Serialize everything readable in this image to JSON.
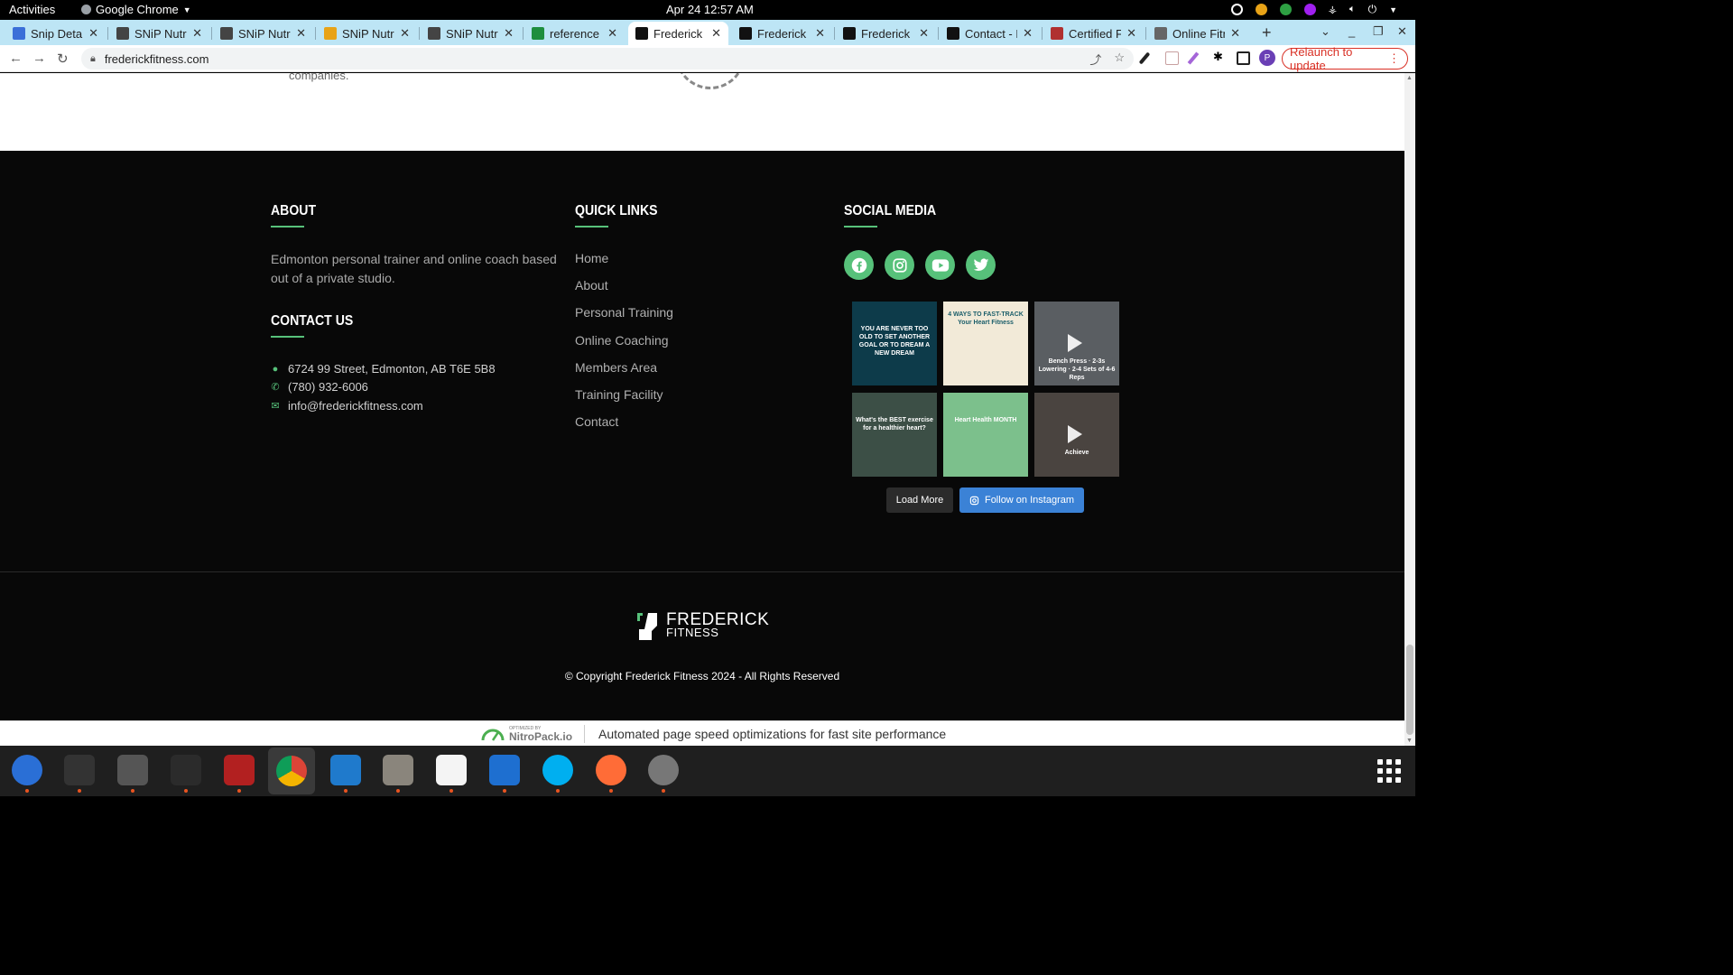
{
  "topbar": {
    "activities": "Activities",
    "app_name": "Google Chrome",
    "clock": "Apr 24  12:57 AM"
  },
  "tabs": [
    {
      "title": "Snip Details",
      "favicon_color": "#3b6fd8"
    },
    {
      "title": "SNiP Nutrition",
      "favicon_color": "#444"
    },
    {
      "title": "SNiP Nutrition",
      "favicon_color": "#444"
    },
    {
      "title": "SNiP Nutrition",
      "favicon_color": "#e8a317"
    },
    {
      "title": "SNiP Nutrition",
      "favicon_color": "#444"
    },
    {
      "title": "reference w",
      "favicon_color": "#1e8e3e"
    },
    {
      "title": "Frederick F",
      "favicon_color": "#111",
      "active": true
    },
    {
      "title": "Frederick F",
      "favicon_color": "#111"
    },
    {
      "title": "Frederick F",
      "favicon_color": "#111"
    },
    {
      "title": "Contact - F",
      "favicon_color": "#111"
    },
    {
      "title": "Certified Fi",
      "favicon_color": "#b03030"
    },
    {
      "title": "Online Fitn",
      "favicon_color": "#666"
    }
  ],
  "toolbar": {
    "url": "frederickfitness.com",
    "relaunch_label": "Relaunch to update",
    "profile_initial": "P"
  },
  "page": {
    "fragment_text": "companies.",
    "about": {
      "heading": "ABOUT",
      "text": "Edmonton personal trainer and online coach based out of a private studio."
    },
    "contact": {
      "heading": "CONTACT US",
      "address": "6724 99 Street, Edmonton, AB T6E 5B8",
      "phone": "(780) 932-6006",
      "email": "info@frederickfitness.com"
    },
    "quick_links": {
      "heading": "QUICK LINKS",
      "items": [
        "Home",
        "About",
        "Personal Training",
        "Online Coaching",
        "Members Area",
        "Training Facility",
        "Contact"
      ]
    },
    "social": {
      "heading": "SOCIAL MEDIA",
      "icons": [
        "facebook-icon",
        "instagram-icon",
        "youtube-icon",
        "twitter-icon"
      ],
      "accent_color": "#57c17a"
    },
    "instagram": {
      "thumbs": [
        {
          "caption": "YOU ARE NEVER TOO OLD TO SET ANOTHER GOAL OR TO DREAM A NEW DREAM",
          "bg": "#0d3b4a",
          "video": false
        },
        {
          "caption": "4 WAYS TO FAST-TRACK Your Heart Fitness",
          "bg": "#f2ead8",
          "video": false
        },
        {
          "caption": "Bench Press · 2-3s Lowering · 2-4 Sets of 4-6 Reps",
          "bg": "#5a5e62",
          "video": true
        },
        {
          "caption": "What's the BEST exercise for a healthier heart?",
          "bg": "#3c4f46",
          "video": false
        },
        {
          "caption": "Heart Health MONTH",
          "bg": "#7cc08c",
          "video": false
        },
        {
          "caption": "Achieve",
          "bg": "#4a4440",
          "video": true
        }
      ],
      "load_more": "Load More",
      "follow": "Follow on Instagram"
    },
    "logo": {
      "line1": "FREDERICK",
      "line2": "FITNESS"
    },
    "copyright": "© Copyright Frederick Fitness 2024 - All Rights Reserved",
    "nitro": {
      "small": "OPTIMIZED BY",
      "brand": "NitroPack.io",
      "message": "Automated page speed optimizations for fast site performance"
    }
  },
  "dock": {
    "apps": [
      "thunderbird-icon",
      "terminal-icon",
      "calculator-icon",
      "system-monitor-icon",
      "filezilla-icon",
      "chrome-icon",
      "vscode-icon",
      "files-icon",
      "text-editor-icon",
      "writer-icon",
      "skype-icon",
      "postman-icon",
      "disks-icon"
    ]
  }
}
